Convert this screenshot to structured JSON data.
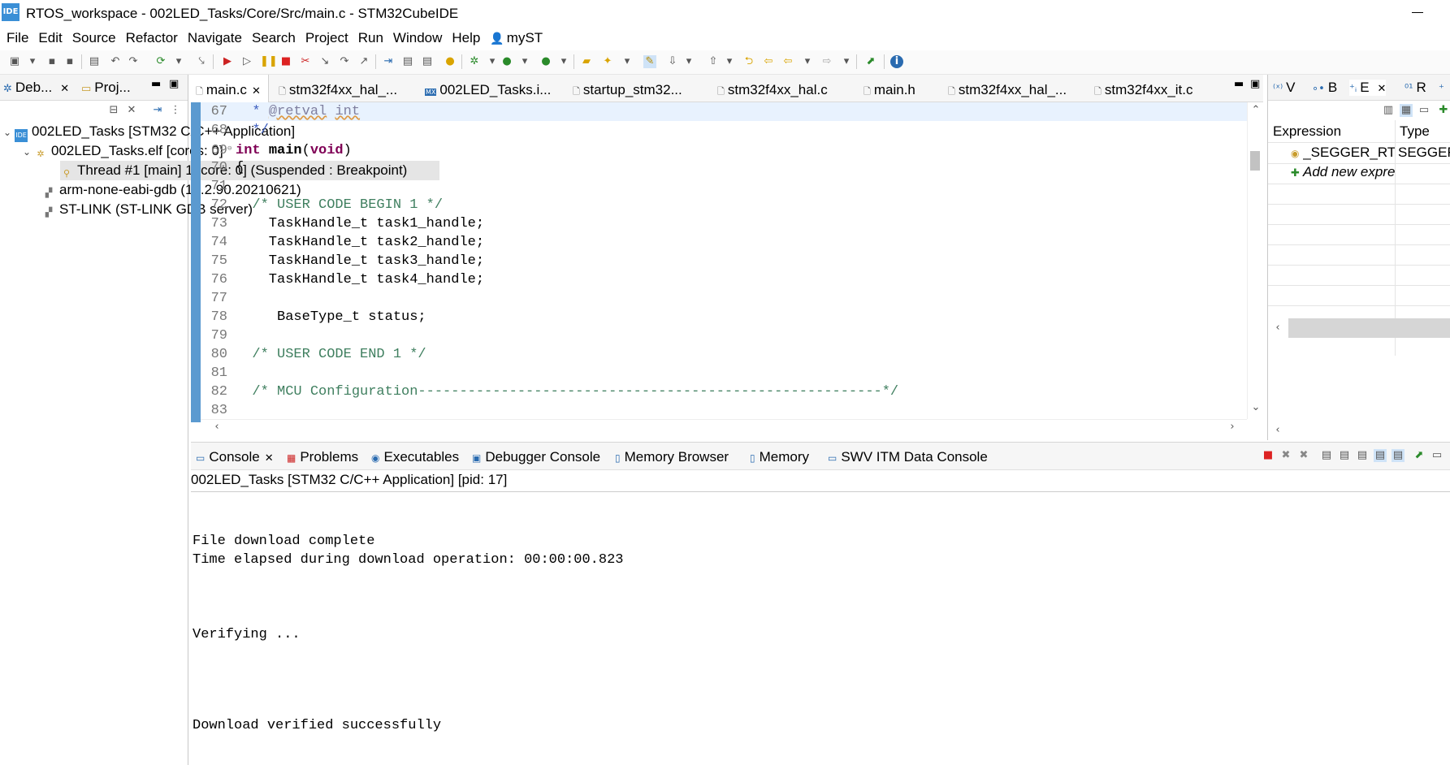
{
  "window": {
    "logo": "IDE",
    "title": "RTOS_workspace - 002LED_Tasks/Core/Src/main.c - STM32CubeIDE"
  },
  "menubar": [
    "File",
    "Edit",
    "Source",
    "Refactor",
    "Navigate",
    "Search",
    "Project",
    "Run",
    "Window",
    "Help",
    "myST"
  ],
  "left_panel": {
    "tabs": [
      {
        "label": "Deb..."
      },
      {
        "label": "Proj..."
      }
    ],
    "tree": [
      {
        "label": "002LED_Tasks [STM32 C/C++ Application]"
      },
      {
        "label": "002LED_Tasks.elf [cores: 0]"
      },
      {
        "label": "Thread #1 [main] 1 [core: 0] (Suspended : Breakpoint)"
      },
      {
        "label": "arm-none-eabi-gdb (10.2.90.20210621)"
      },
      {
        "label": "ST-LINK (ST-LINK GDB server)"
      }
    ]
  },
  "editor": {
    "tabs": [
      {
        "label": "main.c",
        "icon": "c-file-icon"
      },
      {
        "label": "stm32f4xx_hal_...",
        "icon": "h-file-icon"
      },
      {
        "label": "002LED_Tasks.i...",
        "icon": "mx-file-icon"
      },
      {
        "label": "startup_stm32...",
        "icon": "s-file-icon"
      },
      {
        "label": "stm32f4xx_hal.c",
        "icon": "c-file-icon"
      },
      {
        "label": "main.h",
        "icon": "h-file-icon"
      },
      {
        "label": "stm32f4xx_hal_...",
        "icon": "h-file-icon"
      },
      {
        "label": "stm32f4xx_it.c",
        "icon": "c-file-icon"
      }
    ],
    "lines": [
      {
        "num": "67",
        "text": "  * @retval int"
      },
      {
        "num": "68",
        "text": "  */"
      },
      {
        "num": "69",
        "text": "int main(void)"
      },
      {
        "num": "70",
        "text": "{"
      },
      {
        "num": "71",
        "text": ""
      },
      {
        "num": "72",
        "text": "  /* USER CODE BEGIN 1 */"
      },
      {
        "num": "73",
        "text": "    TaskHandle_t task1_handle;"
      },
      {
        "num": "74",
        "text": "    TaskHandle_t task2_handle;"
      },
      {
        "num": "75",
        "text": "    TaskHandle_t task3_handle;"
      },
      {
        "num": "76",
        "text": "    TaskHandle_t task4_handle;"
      },
      {
        "num": "77",
        "text": ""
      },
      {
        "num": "78",
        "text": "     BaseType_t status;"
      },
      {
        "num": "79",
        "text": ""
      },
      {
        "num": "80",
        "text": "  /* USER CODE END 1 */"
      },
      {
        "num": "81",
        "text": ""
      },
      {
        "num": "82",
        "text": "  /* MCU Configuration--------------------------------------------------------*/"
      },
      {
        "num": "83",
        "text": ""
      }
    ]
  },
  "right_panel": {
    "tabs": [
      {
        "label": "V"
      },
      {
        "label": "B"
      },
      {
        "label": "E"
      },
      {
        "label": "R"
      }
    ],
    "columns": [
      "Expression",
      "Type"
    ],
    "rows": [
      {
        "expression": "_SEGGER_RTT",
        "type": "SEGGER_RTT_CB"
      },
      {
        "expression": "Add new expression",
        "type": ""
      }
    ]
  },
  "console": {
    "tabs": [
      {
        "label": "Console"
      },
      {
        "label": "Problems"
      },
      {
        "label": "Executables"
      },
      {
        "label": "Debugger Console"
      },
      {
        "label": "Memory Browser"
      },
      {
        "label": "Memory"
      },
      {
        "label": "SWV ITM Data Console"
      }
    ],
    "description": "002LED_Tasks [STM32 C/C++ Application]  [pid: 17]",
    "lines": [
      "File download complete",
      "Time elapsed during download operation: 00:00:00.823",
      "Verifying ...",
      "Download verified successfully"
    ]
  }
}
